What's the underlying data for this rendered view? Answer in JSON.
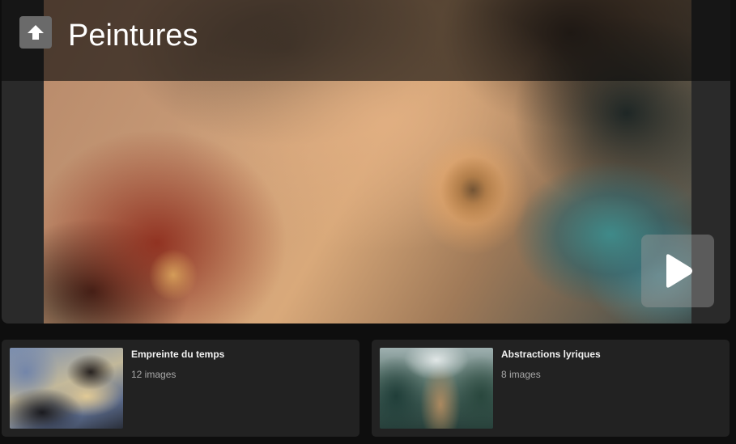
{
  "header": {
    "title": "Peintures",
    "up_icon": "arrow-up-icon"
  },
  "viewer": {
    "next_icon": "play-right-icon"
  },
  "galleries": [
    {
      "title": "Empreinte du temps",
      "count": "12 images"
    },
    {
      "title": "Abstractions lyriques",
      "count": "8 images"
    }
  ],
  "colors": {
    "background": "#0e0e0e",
    "card": "#222222",
    "title_text": "#ffffff",
    "muted_text": "#a8a8a8"
  }
}
